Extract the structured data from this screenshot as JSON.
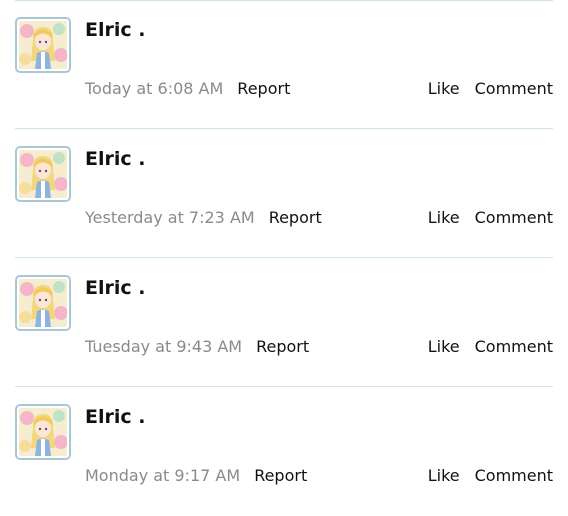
{
  "colors": {
    "divider": "#cfe3ee",
    "avatar_border": "#a9c8d6",
    "timestamp_text": "#8a8a8a",
    "primary_text": "#111111"
  },
  "posts": [
    {
      "author": "Elric .",
      "avatar_icon": "anime-girl-avatar",
      "time": "Today at 6:08 AM",
      "report_label": "Report",
      "like_label": "Like",
      "comment_label": "Comment"
    },
    {
      "author": "Elric .",
      "avatar_icon": "anime-girl-avatar",
      "time": "Yesterday at 7:23 AM",
      "report_label": "Report",
      "like_label": "Like",
      "comment_label": "Comment"
    },
    {
      "author": "Elric .",
      "avatar_icon": "anime-girl-avatar",
      "time": "Tuesday at 9:43 AM",
      "report_label": "Report",
      "like_label": "Like",
      "comment_label": "Comment"
    },
    {
      "author": "Elric .",
      "avatar_icon": "anime-girl-avatar",
      "time": "Monday at 9:17 AM",
      "report_label": "Report",
      "like_label": "Like",
      "comment_label": "Comment"
    }
  ]
}
